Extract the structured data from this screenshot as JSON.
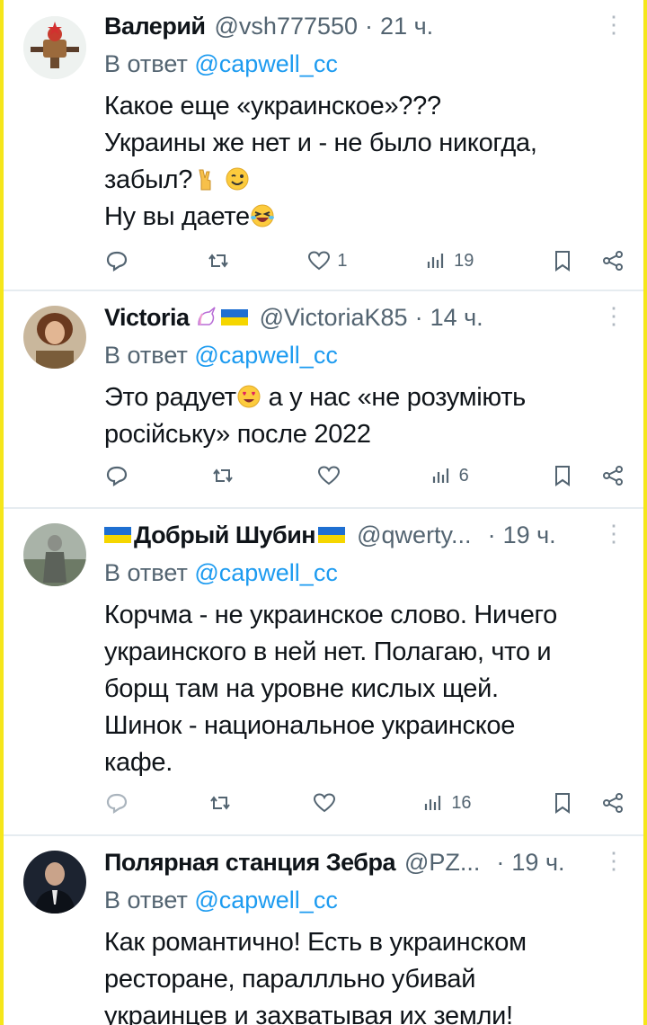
{
  "reply_prefix": "В ответ",
  "reply_target": "@capwell_cc",
  "tweets": [
    {
      "name": "Валерий",
      "handle": "@vsh777550",
      "time": "21 ч.",
      "lines": [
        "Какое еще «украинское»???",
        "Украины же нет и - не было никогда,",
        "забыл?",
        "Ну вы даете"
      ],
      "views": "19",
      "likes": "1"
    },
    {
      "name": "Victoria",
      "handle": "@VictoriaK85",
      "time": "14 ч.",
      "lines": [
        "Это радует",
        "а у нас «не розуміють",
        "російську» после 2022"
      ],
      "views": "6",
      "likes": ""
    },
    {
      "name": "Добрый Шубин",
      "handle": "@qwerty...",
      "time": "19 ч.",
      "lines": [
        "Корчма - не украинское слово. Ничего",
        "украинского в ней нет. Полагаю, что и",
        "борщ там на уровне кислых щей.",
        "Шинок - национальное украинское",
        "кафе."
      ],
      "views": "16",
      "likes": ""
    },
    {
      "name": "Полярная станция Зебра",
      "handle": "@PZ...",
      "time": "19 ч.",
      "lines": [
        "Как романтично! Есть в украинском",
        "ресторане, параллльно убивай",
        "украинцев и захватывая их земли!"
      ],
      "views": "",
      "likes": ""
    }
  ],
  "colors": {
    "link": "#1d9bf0",
    "muted": "#536471",
    "border": "#e6ecf0",
    "frame": "#f5e61a"
  },
  "icons": [
    "reply-icon",
    "retweet-icon",
    "like-icon",
    "views-icon",
    "bookmark-icon",
    "share-icon",
    "more-icon"
  ]
}
